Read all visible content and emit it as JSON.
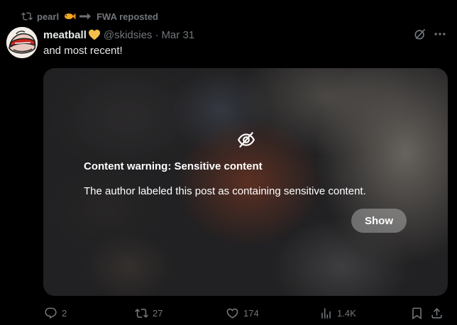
{
  "repost": {
    "name": "pearl",
    "suffix": "FWA reposted",
    "icon": "repost-icon"
  },
  "author": {
    "display_name": "meatball",
    "handle": "@skidsies",
    "separator": "·",
    "date": "Mar 31",
    "badge_emoji": "yellow-heart-icon"
  },
  "tweet": {
    "text": "and most recent!"
  },
  "media": {
    "warning_title": "Content warning: Sensitive content",
    "warning_body": "The author labeled this post as containing sensitive content.",
    "show_label": "Show",
    "warning_icon": "eye-slash-icon"
  },
  "actions": {
    "replies": "2",
    "reposts": "27",
    "likes": "174",
    "views": "1.4K"
  },
  "colors": {
    "background": "#000000",
    "text": "#e7e9ea",
    "muted": "#71767b",
    "accent_heart": "#f5c04a"
  }
}
